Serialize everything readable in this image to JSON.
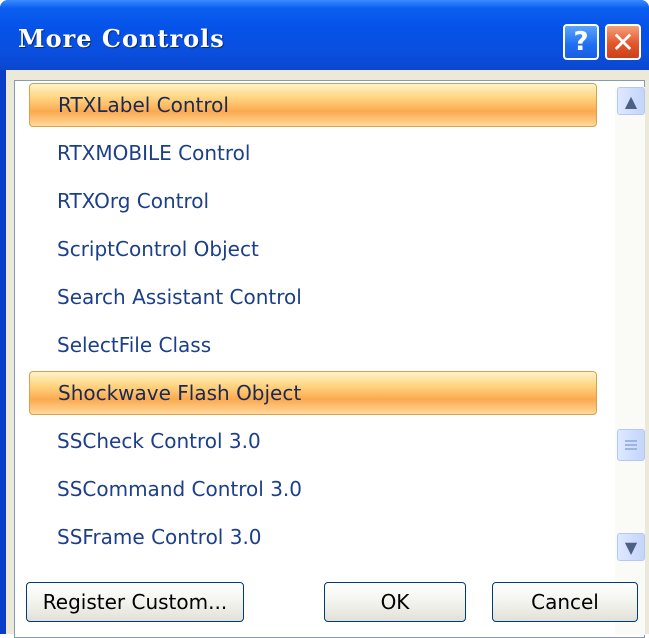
{
  "window": {
    "title": "More Controls",
    "help_label": "?",
    "close_label": "✕"
  },
  "list": {
    "items": [
      {
        "label": "RTXLabel Control",
        "selected": true
      },
      {
        "label": "RTXMOBILE Control",
        "selected": false
      },
      {
        "label": "RTXOrg Control",
        "selected": false
      },
      {
        "label": "ScriptControl Object",
        "selected": false
      },
      {
        "label": "Search Assistant Control",
        "selected": false
      },
      {
        "label": "SelectFile Class",
        "selected": false
      },
      {
        "label": "Shockwave Flash Object",
        "selected": true
      },
      {
        "label": "SSCheck Control 3.0",
        "selected": false
      },
      {
        "label": "SSCommand Control 3.0",
        "selected": false
      },
      {
        "label": "SSFrame Control 3.0",
        "selected": false
      }
    ]
  },
  "scrollbar": {
    "up_icon": "chevron-up-icon",
    "down_icon": "chevron-down-icon",
    "up_glyph": "▲",
    "down_glyph": "▼"
  },
  "buttons": {
    "register": "Register Custom...",
    "ok": "OK",
    "cancel": "Cancel"
  }
}
